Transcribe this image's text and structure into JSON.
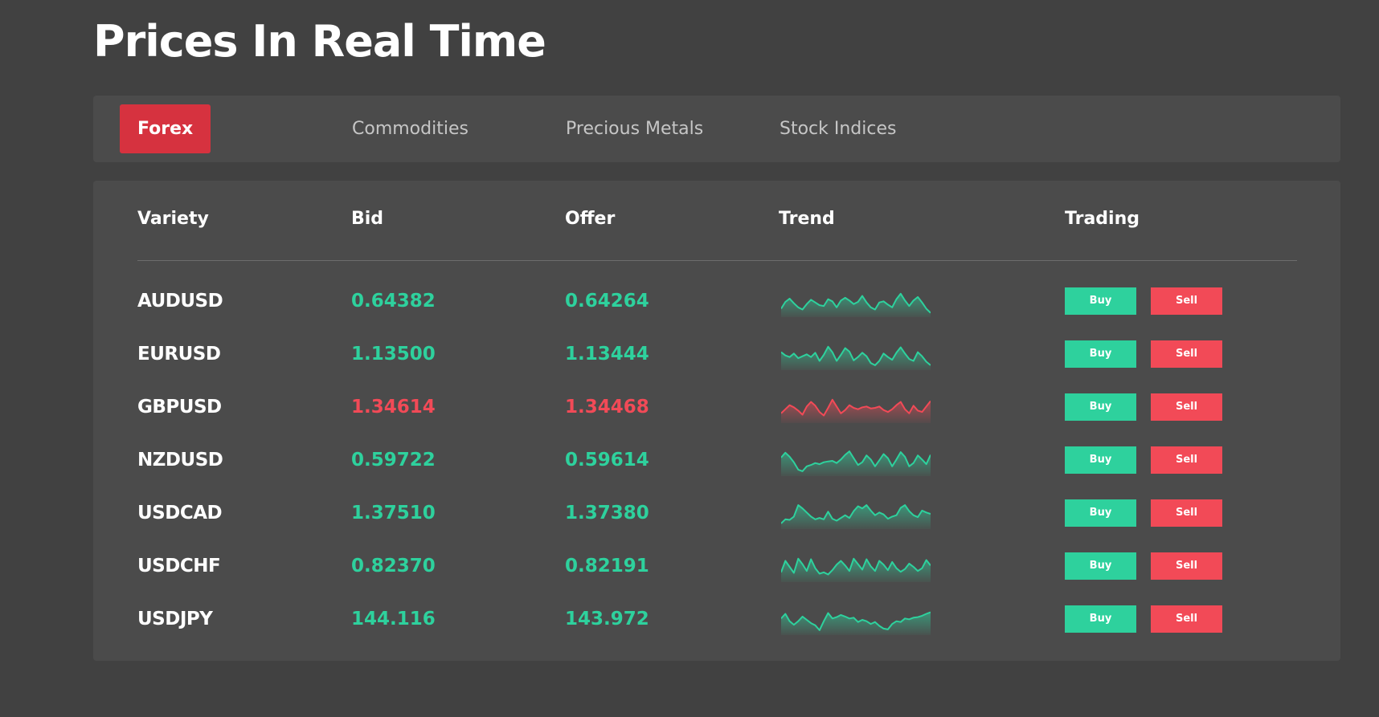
{
  "page_title": "Prices In Real Time",
  "tabs": [
    {
      "label": "Forex",
      "active": true
    },
    {
      "label": "Commodities",
      "active": false
    },
    {
      "label": "Precious Metals",
      "active": false
    },
    {
      "label": "Stock Indices",
      "active": false
    }
  ],
  "table": {
    "headers": [
      "Variety",
      "Bid",
      "Offer",
      "Trend",
      "Trading"
    ],
    "buy_label": "Buy",
    "sell_label": "Sell",
    "rows": [
      {
        "variety": "AUDUSD",
        "bid": "0.64382",
        "offer": "0.64264",
        "direction": "up",
        "trend": [
          0.25,
          0.5,
          0.62,
          0.45,
          0.3,
          0.22,
          0.42,
          0.58,
          0.48,
          0.38,
          0.35,
          0.6,
          0.52,
          0.3,
          0.55,
          0.65,
          0.55,
          0.42,
          0.5,
          0.72,
          0.48,
          0.3,
          0.22,
          0.48,
          0.52,
          0.4,
          0.3,
          0.6,
          0.8,
          0.55,
          0.35,
          0.55,
          0.68,
          0.48,
          0.25,
          0.1
        ]
      },
      {
        "variety": "EURUSD",
        "bid": "1.13500",
        "offer": "1.13444",
        "direction": "up",
        "trend": [
          0.6,
          0.48,
          0.42,
          0.55,
          0.38,
          0.45,
          0.52,
          0.42,
          0.58,
          0.28,
          0.5,
          0.8,
          0.6,
          0.28,
          0.5,
          0.75,
          0.62,
          0.3,
          0.42,
          0.58,
          0.45,
          0.2,
          0.12,
          0.28,
          0.55,
          0.42,
          0.32,
          0.58,
          0.78,
          0.55,
          0.35,
          0.28,
          0.6,
          0.45,
          0.25,
          0.12
        ]
      },
      {
        "variety": "GBPUSD",
        "bid": "1.34614",
        "offer": "1.34468",
        "direction": "down",
        "trend": [
          0.3,
          0.45,
          0.6,
          0.52,
          0.4,
          0.25,
          0.55,
          0.72,
          0.58,
          0.35,
          0.22,
          0.5,
          0.8,
          0.55,
          0.3,
          0.42,
          0.6,
          0.5,
          0.45,
          0.52,
          0.55,
          0.48,
          0.5,
          0.55,
          0.42,
          0.35,
          0.45,
          0.6,
          0.72,
          0.45,
          0.3,
          0.58,
          0.4,
          0.35,
          0.55,
          0.75
        ]
      },
      {
        "variety": "NZDUSD",
        "bid": "0.59722",
        "offer": "0.59614",
        "direction": "up",
        "trend": [
          0.62,
          0.8,
          0.65,
          0.45,
          0.18,
          0.12,
          0.3,
          0.35,
          0.42,
          0.38,
          0.45,
          0.48,
          0.5,
          0.42,
          0.55,
          0.72,
          0.85,
          0.6,
          0.35,
          0.45,
          0.7,
          0.55,
          0.3,
          0.52,
          0.75,
          0.6,
          0.3,
          0.55,
          0.82,
          0.65,
          0.3,
          0.42,
          0.7,
          0.55,
          0.38,
          0.72
        ]
      },
      {
        "variety": "USDCAD",
        "bid": "1.37510",
        "offer": "1.37380",
        "direction": "up",
        "trend": [
          0.15,
          0.3,
          0.28,
          0.4,
          0.82,
          0.7,
          0.55,
          0.4,
          0.3,
          0.35,
          0.3,
          0.58,
          0.32,
          0.25,
          0.35,
          0.45,
          0.35,
          0.6,
          0.78,
          0.7,
          0.82,
          0.62,
          0.45,
          0.55,
          0.48,
          0.32,
          0.4,
          0.45,
          0.72,
          0.82,
          0.6,
          0.45,
          0.38,
          0.62,
          0.55,
          0.5
        ]
      },
      {
        "variety": "USDCHF",
        "bid": "0.82370",
        "offer": "0.82191",
        "direction": "up",
        "trend": [
          0.3,
          0.72,
          0.5,
          0.28,
          0.8,
          0.6,
          0.35,
          0.78,
          0.45,
          0.25,
          0.3,
          0.22,
          0.38,
          0.58,
          0.72,
          0.55,
          0.35,
          0.8,
          0.6,
          0.4,
          0.78,
          0.52,
          0.35,
          0.72,
          0.58,
          0.38,
          0.68,
          0.45,
          0.32,
          0.42,
          0.62,
          0.5,
          0.35,
          0.45,
          0.75,
          0.55
        ]
      },
      {
        "variety": "USDJPY",
        "bid": "144.116",
        "offer": "143.972",
        "direction": "up",
        "trend": [
          0.55,
          0.72,
          0.45,
          0.32,
          0.45,
          0.62,
          0.5,
          0.38,
          0.3,
          0.12,
          0.45,
          0.75,
          0.55,
          0.6,
          0.68,
          0.62,
          0.55,
          0.58,
          0.42,
          0.5,
          0.45,
          0.35,
          0.42,
          0.28,
          0.18,
          0.15,
          0.35,
          0.45,
          0.42,
          0.55,
          0.52,
          0.58,
          0.6,
          0.65,
          0.72,
          0.78
        ]
      }
    ]
  },
  "colors": {
    "up": "#2ed19d",
    "down": "#f24a57",
    "active_tab": "#d6323f"
  }
}
